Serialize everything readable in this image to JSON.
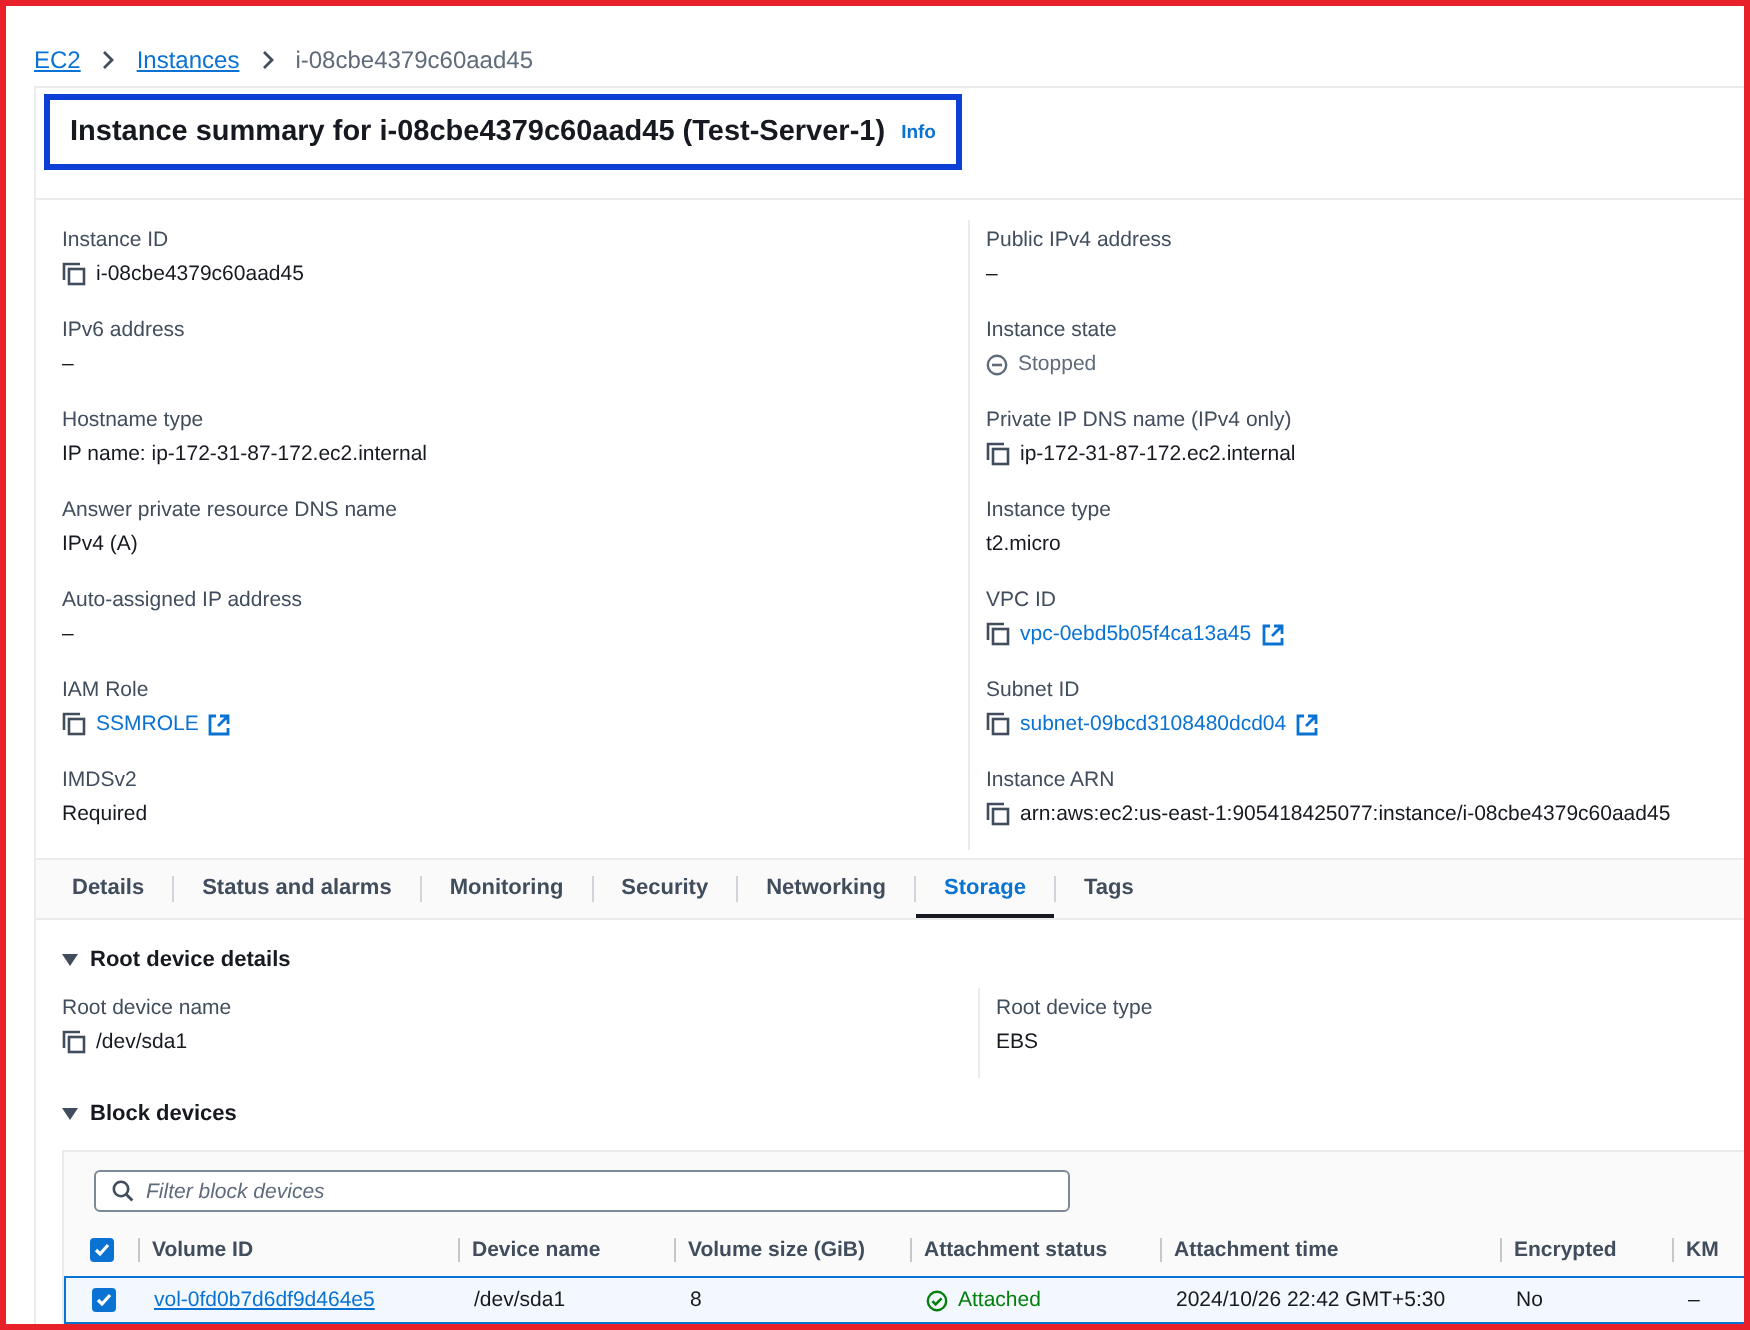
{
  "breadcrumb": [
    {
      "label": "EC2",
      "kind": "link"
    },
    {
      "label": "Instances",
      "kind": "link"
    },
    {
      "label": "i-08cbe4379c60aad45",
      "kind": "current"
    }
  ],
  "summary": {
    "title": "Instance summary for i-08cbe4379c60aad45 (Test-Server-1)",
    "info": "Info"
  },
  "details": {
    "left": [
      {
        "label": "Instance ID",
        "value": "i-08cbe4379c60aad45",
        "kind": "copy"
      },
      {
        "label": "IPv6 address",
        "value": "–",
        "kind": "text"
      },
      {
        "label": "Hostname type",
        "value": "IP name: ip-172-31-87-172.ec2.internal",
        "kind": "text"
      },
      {
        "label": "Answer private resource DNS name",
        "value": "IPv4 (A)",
        "kind": "text"
      },
      {
        "label": "Auto-assigned IP address",
        "value": "–",
        "kind": "text"
      },
      {
        "label": "IAM Role",
        "value": "SSMROLE",
        "kind": "copy_link"
      },
      {
        "label": "IMDSv2",
        "value": "Required",
        "kind": "text"
      }
    ],
    "right": [
      {
        "label": "Public IPv4 address",
        "value": "–",
        "kind": "text"
      },
      {
        "label": "Instance state",
        "value": "Stopped",
        "kind": "status"
      },
      {
        "label": "Private IP DNS name (IPv4 only)",
        "value": "ip-172-31-87-172.ec2.internal",
        "kind": "copy"
      },
      {
        "label": "Instance type",
        "value": "t2.micro",
        "kind": "text"
      },
      {
        "label": "VPC ID",
        "value": "vpc-0ebd5b05f4ca13a45",
        "kind": "copy_link"
      },
      {
        "label": "Subnet ID",
        "value": "subnet-09bcd3108480dcd04",
        "kind": "copy_link"
      },
      {
        "label": "Instance ARN",
        "value": "arn:aws:ec2:us-east-1:905418425077:instance/i-08cbe4379c60aad45",
        "kind": "copy"
      }
    ]
  },
  "tabs": [
    {
      "label": "Details",
      "selected": false
    },
    {
      "label": "Status and alarms",
      "selected": false
    },
    {
      "label": "Monitoring",
      "selected": false
    },
    {
      "label": "Security",
      "selected": false
    },
    {
      "label": "Networking",
      "selected": false
    },
    {
      "label": "Storage",
      "selected": true
    },
    {
      "label": "Tags",
      "selected": false
    }
  ],
  "storage": {
    "root_section": {
      "title": "Root device details",
      "expanded": true
    },
    "root_fields": [
      {
        "label": "Root device name",
        "value": "/dev/sda1",
        "kind": "copy"
      },
      {
        "label": "Root device type",
        "value": "EBS",
        "kind": "text"
      }
    ],
    "block_section": {
      "title": "Block devices",
      "expanded": true
    },
    "filter": {
      "placeholder": "Filter block devices"
    },
    "table": {
      "all_selected": true,
      "columns": [
        "Volume ID",
        "Device name",
        "Volume size (GiB)",
        "Attachment status",
        "Attachment time",
        "Encrypted",
        "KM"
      ],
      "rows": [
        {
          "selected": true,
          "volume_id": "vol-0fd0b7d6df9d464e5",
          "device_name": "/dev/sda1",
          "size": "8",
          "status": "Attached",
          "time": "2024/10/26 22:42 GMT+5:30",
          "encrypted": "No",
          "kms": "–"
        }
      ]
    }
  }
}
